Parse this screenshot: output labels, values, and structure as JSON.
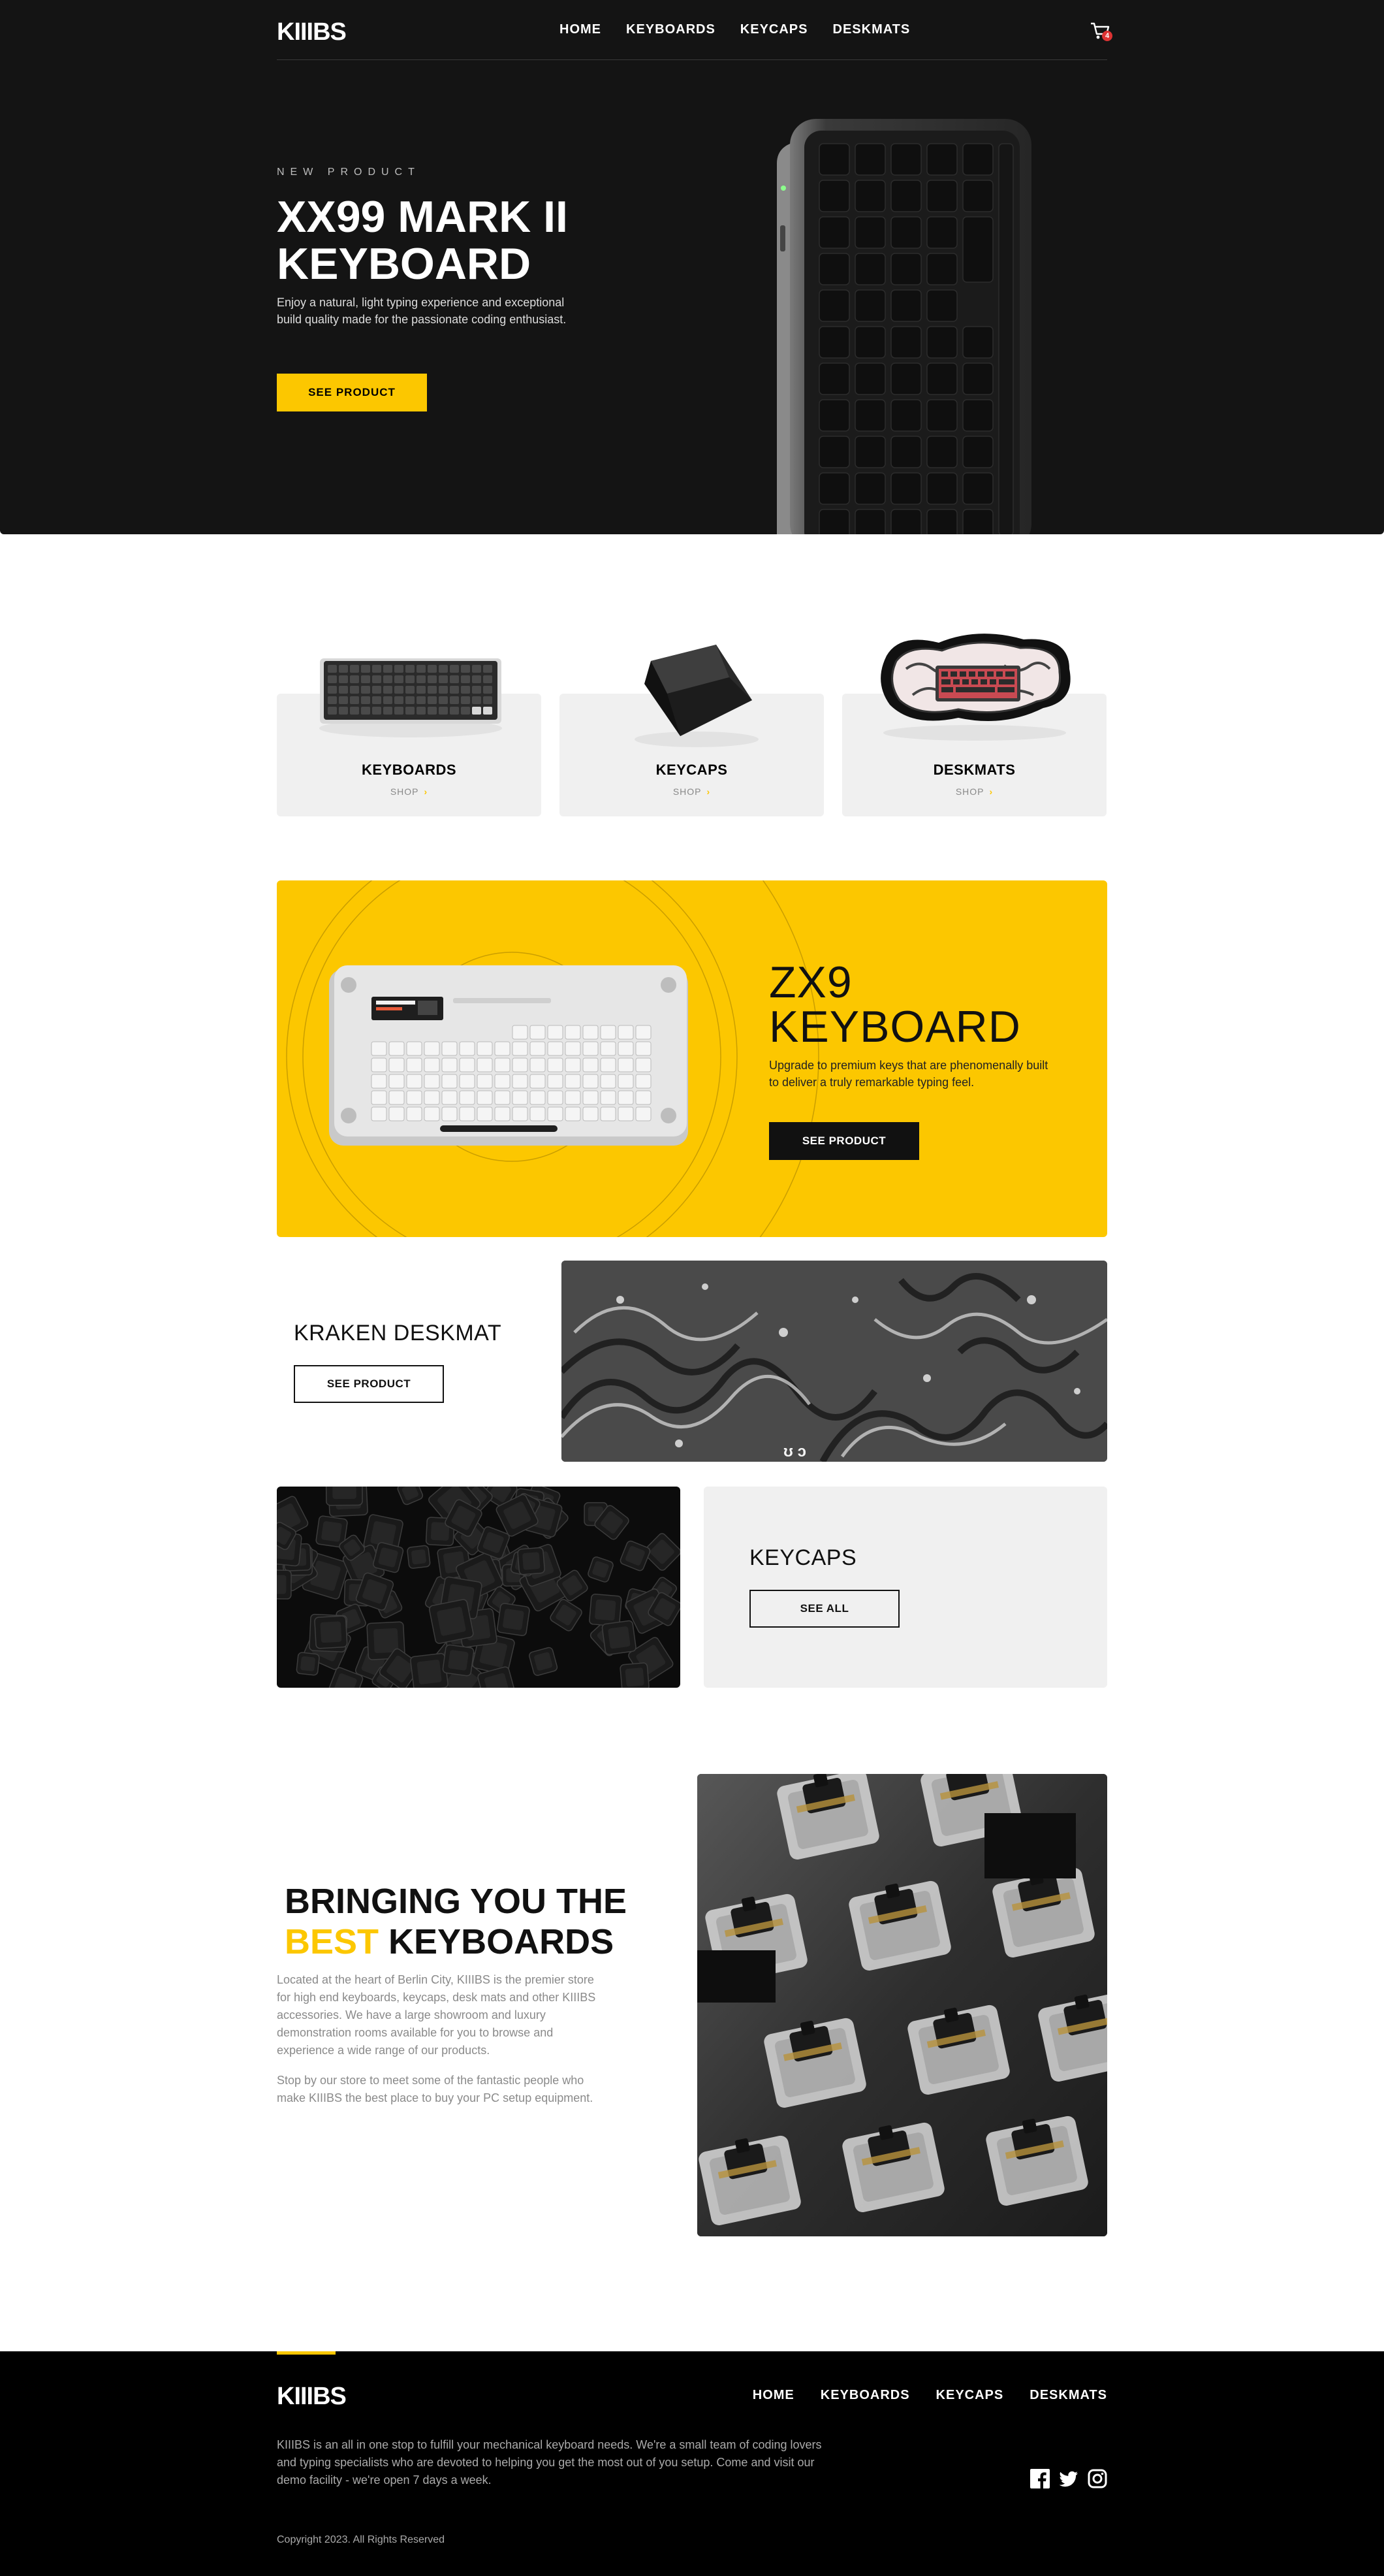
{
  "header": {
    "logo": "KIIIBS",
    "nav": [
      "HOME",
      "KEYBOARDS",
      "KEYCAPS",
      "DESKMATS"
    ],
    "cart_count": "4"
  },
  "hero": {
    "overline": "NEW PRODUCT",
    "title": "XX99 MARK II KEYBOARD",
    "description": "Enjoy a natural, light typing experience and exceptional build quality made for the passionate coding enthusiast.",
    "cta": "SEE PRODUCT"
  },
  "categories": [
    {
      "title": "KEYBOARDS",
      "link": "SHOP"
    },
    {
      "title": "KEYCAPS",
      "link": "SHOP"
    },
    {
      "title": "DESKMATS",
      "link": "SHOP"
    }
  ],
  "zx9": {
    "title_line1": "ZX9",
    "title_line2": "KEYBOARD",
    "description": "Upgrade to premium keys that are phenomenally built to deliver a truly remarkable typing feel.",
    "cta": "SEE PRODUCT"
  },
  "kraken": {
    "title": "KRAKEN DESKMAT",
    "cta": "SEE PRODUCT"
  },
  "keycaps": {
    "title": "KEYCAPS",
    "cta": "SEE ALL"
  },
  "about": {
    "title_line1": "BRINGING YOU THE",
    "title_highlight": "BEST",
    "title_rest": "KEYBOARDS",
    "paragraph1": "Located at the heart of Berlin City, KIIIBS is the premier store for high end keyboards, keycaps, desk mats and other KIIIBS accessories. We have a large showroom and luxury demonstration rooms available for you to browse and experience a wide range of our products.",
    "paragraph2": "Stop by our store to meet some of the fantastic people who make KIIIBS the best place to buy your PC setup equipment."
  },
  "footer": {
    "logo": "KIIIBS",
    "nav": [
      "HOME",
      "KEYBOARDS",
      "KEYCAPS",
      "DESKMATS"
    ],
    "description": "KIIIBS is an all in one stop to fulfill your mechanical keyboard needs. We're a small team of coding lovers and typing specialists who are devoted to helping you get the most out of you setup. Come and visit our demo facility - we're open 7 days a week.",
    "copyright": "Copyright 2023. All Rights Reserved",
    "social": [
      "facebook-icon",
      "twitter-icon",
      "instagram-icon"
    ]
  },
  "colors": {
    "accent": "#fcc700",
    "dark": "#141414",
    "panel": "#f0f0f0",
    "badge": "#dd3333"
  }
}
